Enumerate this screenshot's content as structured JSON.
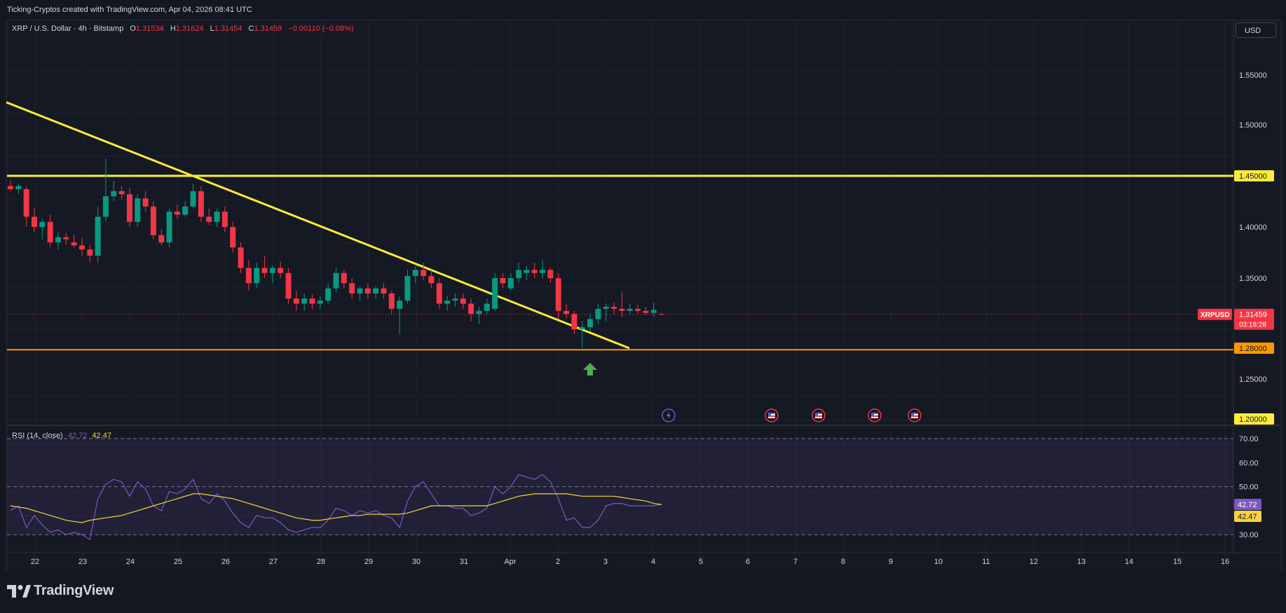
{
  "header": {
    "attribution": "Ticking-Cryptos created with TradingView.com, Apr 04, 2026 08:41 UTC"
  },
  "legend": {
    "symbol": "XRP / U.S. Dollar · 4h · Bitstamp",
    "o_label": "O",
    "o": "1.31534",
    "h_label": "H",
    "h": "1.31624",
    "l_label": "L",
    "l": "1.31454",
    "c_label": "C",
    "c": "1.31459",
    "change": "−0.00110 (−0.08%)"
  },
  "currency_button": "USD",
  "price_axis": {
    "ticks": [
      "1.55000",
      "1.50000",
      "1.40000",
      "1.35000",
      "1.25000"
    ],
    "levels": [
      {
        "label": "1.45000",
        "color": "#ffeb3b"
      },
      {
        "label": "1.28000",
        "color": "#ff9800"
      },
      {
        "label": "1.20000",
        "color": "#ffeb3b"
      }
    ],
    "current_symbol": "XRPUSD",
    "current_price": "1.31459",
    "countdown": "03:18:28"
  },
  "rsi": {
    "name": "RSI (14, close)",
    "value": "42.72",
    "ma_value": "42.47",
    "ticks": [
      "70.00",
      "60.00",
      "50.00",
      "30.00"
    ],
    "rsi_color": "#7e57c2",
    "ma_color": "#f7d23e"
  },
  "time_axis": [
    "22",
    "23",
    "24",
    "25",
    "26",
    "27",
    "28",
    "29",
    "30",
    "31",
    "Apr",
    "2",
    "3",
    "4",
    "5",
    "6",
    "7",
    "8",
    "9",
    "10",
    "11",
    "12",
    "13",
    "14",
    "15",
    "16"
  ],
  "colors": {
    "up": "#089981",
    "down": "#f23645",
    "background": "#151924",
    "grid": "#1f2330"
  },
  "footer": {
    "brand": "TradingView"
  },
  "chart_data": {
    "type": "candlestick",
    "title": "XRP / U.S. Dollar · 4h · Bitstamp",
    "ylim": [
      1.2,
      1.57
    ],
    "candles": [
      [
        1.44,
        1.445,
        1.435,
        1.437
      ],
      [
        1.437,
        1.442,
        1.432,
        1.44
      ],
      [
        1.437,
        1.44,
        1.4,
        1.41
      ],
      [
        1.41,
        1.418,
        1.395,
        1.4
      ],
      [
        1.4,
        1.408,
        1.388,
        1.405
      ],
      [
        1.405,
        1.412,
        1.38,
        1.385
      ],
      [
        1.385,
        1.395,
        1.378,
        1.39
      ],
      [
        1.39,
        1.394,
        1.383,
        1.388
      ],
      [
        1.385,
        1.392,
        1.38,
        1.382
      ],
      [
        1.382,
        1.389,
        1.372,
        1.378
      ],
      [
        1.378,
        1.382,
        1.365,
        1.372
      ],
      [
        1.372,
        1.42,
        1.365,
        1.41
      ],
      [
        1.41,
        1.467,
        1.405,
        1.43
      ],
      [
        1.43,
        1.445,
        1.425,
        1.435
      ],
      [
        1.435,
        1.44,
        1.427,
        1.432
      ],
      [
        1.432,
        1.438,
        1.4,
        1.405
      ],
      [
        1.405,
        1.432,
        1.4,
        1.428
      ],
      [
        1.428,
        1.435,
        1.415,
        1.42
      ],
      [
        1.42,
        1.425,
        1.388,
        1.392
      ],
      [
        1.392,
        1.398,
        1.382,
        1.385
      ],
      [
        1.385,
        1.418,
        1.38,
        1.415
      ],
      [
        1.415,
        1.422,
        1.408,
        1.412
      ],
      [
        1.412,
        1.425,
        1.41,
        1.42
      ],
      [
        1.42,
        1.442,
        1.418,
        1.435
      ],
      [
        1.435,
        1.44,
        1.405,
        1.41
      ],
      [
        1.41,
        1.418,
        1.402,
        1.405
      ],
      [
        1.405,
        1.418,
        1.4,
        1.415
      ],
      [
        1.415,
        1.42,
        1.395,
        1.4
      ],
      [
        1.4,
        1.405,
        1.375,
        1.38
      ],
      [
        1.38,
        1.385,
        1.355,
        1.36
      ],
      [
        1.36,
        1.368,
        1.338,
        1.345
      ],
      [
        1.345,
        1.365,
        1.34,
        1.36
      ],
      [
        1.36,
        1.372,
        1.35,
        1.355
      ],
      [
        1.355,
        1.362,
        1.345,
        1.36
      ],
      [
        1.36,
        1.366,
        1.35,
        1.355
      ],
      [
        1.355,
        1.36,
        1.325,
        1.33
      ],
      [
        1.33,
        1.338,
        1.318,
        1.325
      ],
      [
        1.325,
        1.335,
        1.318,
        1.33
      ],
      [
        1.33,
        1.334,
        1.32,
        1.325
      ],
      [
        1.325,
        1.332,
        1.32,
        1.328
      ],
      [
        1.328,
        1.345,
        1.325,
        1.34
      ],
      [
        1.34,
        1.36,
        1.336,
        1.355
      ],
      [
        1.355,
        1.358,
        1.34,
        1.345
      ],
      [
        1.345,
        1.35,
        1.33,
        1.335
      ],
      [
        1.335,
        1.342,
        1.328,
        1.34
      ],
      [
        1.34,
        1.345,
        1.33,
        1.335
      ],
      [
        1.335,
        1.342,
        1.33,
        1.34
      ],
      [
        1.34,
        1.345,
        1.33,
        1.335
      ],
      [
        1.335,
        1.338,
        1.315,
        1.32
      ],
      [
        1.32,
        1.332,
        1.295,
        1.328
      ],
      [
        1.328,
        1.358,
        1.325,
        1.352
      ],
      [
        1.352,
        1.362,
        1.345,
        1.358
      ],
      [
        1.358,
        1.365,
        1.348,
        1.352
      ],
      [
        1.352,
        1.358,
        1.34,
        1.345
      ],
      [
        1.345,
        1.35,
        1.32,
        1.325
      ],
      [
        1.325,
        1.333,
        1.318,
        1.328
      ],
      [
        1.328,
        1.335,
        1.322,
        1.33
      ],
      [
        1.33,
        1.335,
        1.32,
        1.325
      ],
      [
        1.325,
        1.33,
        1.308,
        1.315
      ],
      [
        1.315,
        1.322,
        1.305,
        1.318
      ],
      [
        1.318,
        1.33,
        1.315,
        1.325
      ],
      [
        1.32,
        1.355,
        1.318,
        1.35
      ],
      [
        1.35,
        1.355,
        1.34,
        1.345
      ],
      [
        1.34,
        1.355,
        1.338,
        1.35
      ],
      [
        1.35,
        1.365,
        1.345,
        1.358
      ],
      [
        1.355,
        1.362,
        1.348,
        1.358
      ],
      [
        1.358,
        1.365,
        1.35,
        1.355
      ],
      [
        1.355,
        1.368,
        1.35,
        1.358
      ],
      [
        1.358,
        1.36,
        1.345,
        1.35
      ],
      [
        1.35,
        1.355,
        1.31,
        1.318
      ],
      [
        1.318,
        1.325,
        1.31,
        1.315
      ],
      [
        1.315,
        1.318,
        1.295,
        1.3
      ],
      [
        1.3,
        1.308,
        1.282,
        1.302
      ],
      [
        1.302,
        1.315,
        1.298,
        1.31
      ],
      [
        1.31,
        1.325,
        1.305,
        1.32
      ],
      [
        1.32,
        1.325,
        1.308,
        1.322
      ],
      [
        1.322,
        1.326,
        1.315,
        1.32
      ],
      [
        1.32,
        1.337,
        1.312,
        1.318
      ],
      [
        1.318,
        1.325,
        1.314,
        1.32
      ],
      [
        1.32,
        1.324,
        1.315,
        1.318
      ],
      [
        1.318,
        1.322,
        1.314,
        1.316
      ],
      [
        1.316,
        1.326,
        1.313,
        1.319
      ],
      [
        1.315,
        1.316,
        1.3145,
        1.3146
      ]
    ],
    "rsi_values": [
      40,
      42,
      33,
      38,
      34,
      31,
      32,
      30,
      31,
      30,
      28,
      45,
      51,
      53,
      52,
      46,
      52,
      49,
      42,
      40,
      48,
      47,
      49,
      53,
      45,
      43,
      47,
      44,
      39,
      35,
      33,
      38,
      37,
      37,
      35,
      32,
      31,
      32,
      33,
      33,
      36,
      41,
      40,
      38,
      40,
      39,
      40,
      38,
      37,
      33,
      44,
      50,
      52,
      47,
      42,
      42,
      41,
      41,
      38,
      39,
      41,
      50,
      47,
      50,
      55,
      54,
      53,
      55,
      52,
      45,
      36,
      37,
      33,
      33,
      36,
      42,
      43,
      43,
      42,
      42,
      42,
      42,
      42.72
    ],
    "rsi_ma_values": [
      42,
      41.5,
      41,
      40,
      39,
      38,
      37,
      36,
      35.5,
      35,
      36,
      36.5,
      37,
      37.5,
      38,
      39,
      40,
      41,
      42,
      43,
      44,
      45,
      46,
      47,
      47,
      46.5,
      46,
      45.5,
      45,
      44,
      43,
      42,
      41,
      40,
      39,
      38,
      37,
      36.5,
      36,
      36,
      36.5,
      37,
      37.5,
      38,
      38,
      38.5,
      38.5,
      38.5,
      38.5,
      38.5,
      39,
      40,
      41,
      42,
      42,
      42,
      42,
      42,
      42,
      42,
      42,
      43,
      44,
      45,
      46,
      46.5,
      47,
      47,
      47,
      47,
      47,
      46.5,
      46,
      46,
      46,
      46,
      46,
      45.5,
      45,
      44.5,
      44,
      43,
      42.47
    ]
  }
}
